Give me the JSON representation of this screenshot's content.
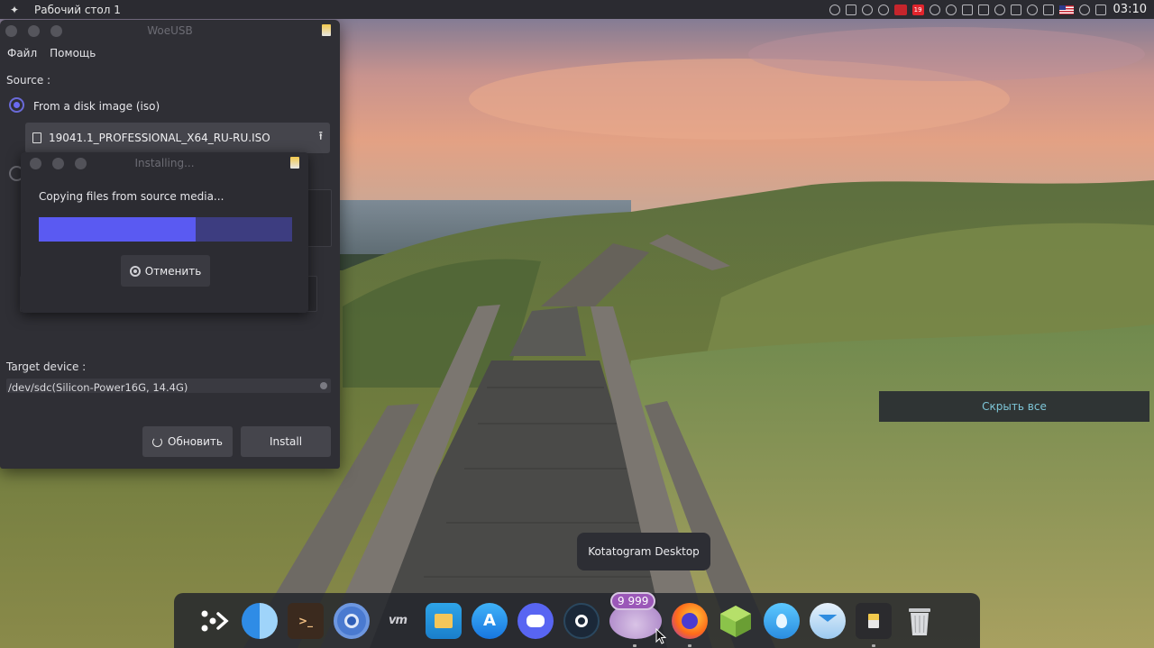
{
  "top_panel": {
    "workspace_title": "Рабочий стол 1",
    "tray_badge": "19",
    "clock": "03:10"
  },
  "woeusb": {
    "title": "WoeUSB",
    "menu": [
      "Файл",
      "Помощь"
    ],
    "source_label": "Source :",
    "option_disk_image": "From a disk image (iso)",
    "iso_file": "19041.1_PROFESSIONAL_X64_RU-RU.ISO",
    "target_label": "Target device :",
    "target_device": "/dev/sdc(Silicon-Power16G, 14.4G)",
    "refresh_label": "Обновить",
    "install_label": "Install"
  },
  "installing": {
    "title": "Installing...",
    "status": "Copying files from source media...",
    "progress": 0.62,
    "cancel_label": "Отменить"
  },
  "desktop": {
    "hide_all_label": "Скрыть все"
  },
  "tooltip": {
    "text": "Kotatogram Desktop"
  },
  "dock": {
    "kotatogram_badge": "9 999",
    "items": [
      "launcher-icon",
      "finder-icon",
      "terminal-icon",
      "chromium-icon",
      "vm-icon",
      "files-icon",
      "app-store-icon",
      "discord-icon",
      "steam-icon",
      "kotatogram-icon",
      "firefox-icon",
      "box-icon",
      "drop-icon",
      "mail-icon",
      "usb-icon",
      "trash-icon"
    ]
  },
  "colors": {
    "accent": "#5a5af2",
    "progress_track": "#3d3d80",
    "panel": "#2b2b31",
    "window": "#2f2f35"
  }
}
